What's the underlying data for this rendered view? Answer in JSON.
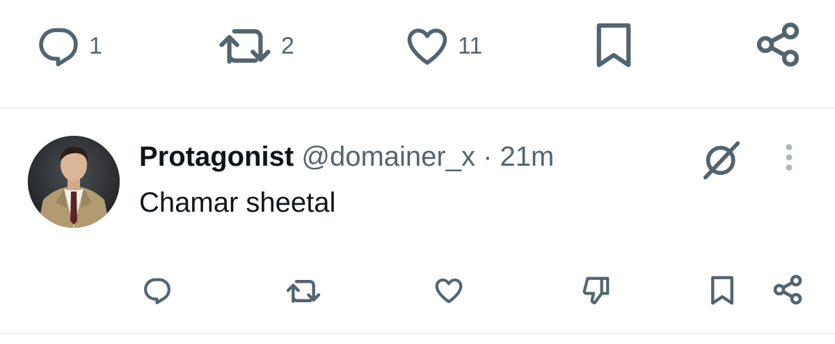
{
  "main_tweet_actions": {
    "reply": {
      "icon": "reply-icon",
      "count": "1"
    },
    "retweet": {
      "icon": "retweet-icon",
      "count": "2"
    },
    "like": {
      "icon": "heart-icon",
      "count": "11"
    },
    "bookmark": {
      "icon": "bookmark-icon"
    },
    "share": {
      "icon": "share-icon"
    }
  },
  "reply": {
    "avatar": "user-avatar",
    "display_name": "Protagonist",
    "handle": "@domainer_x",
    "separator": "·",
    "time": "21m",
    "text": "Chamar sheetal",
    "grok_icon": "grok-icon",
    "more_icon": "more-vertical-icon",
    "actions": {
      "reply": {
        "icon": "reply-icon"
      },
      "retweet": {
        "icon": "retweet-icon"
      },
      "like": {
        "icon": "heart-icon"
      },
      "dislike": {
        "icon": "thumbs-down-icon"
      },
      "bookmark": {
        "icon": "bookmark-icon"
      },
      "share": {
        "icon": "share-icon"
      }
    }
  },
  "colors": {
    "icon_gray": "#536471",
    "text_primary": "#0f1419",
    "divider": "#eff3f4"
  }
}
